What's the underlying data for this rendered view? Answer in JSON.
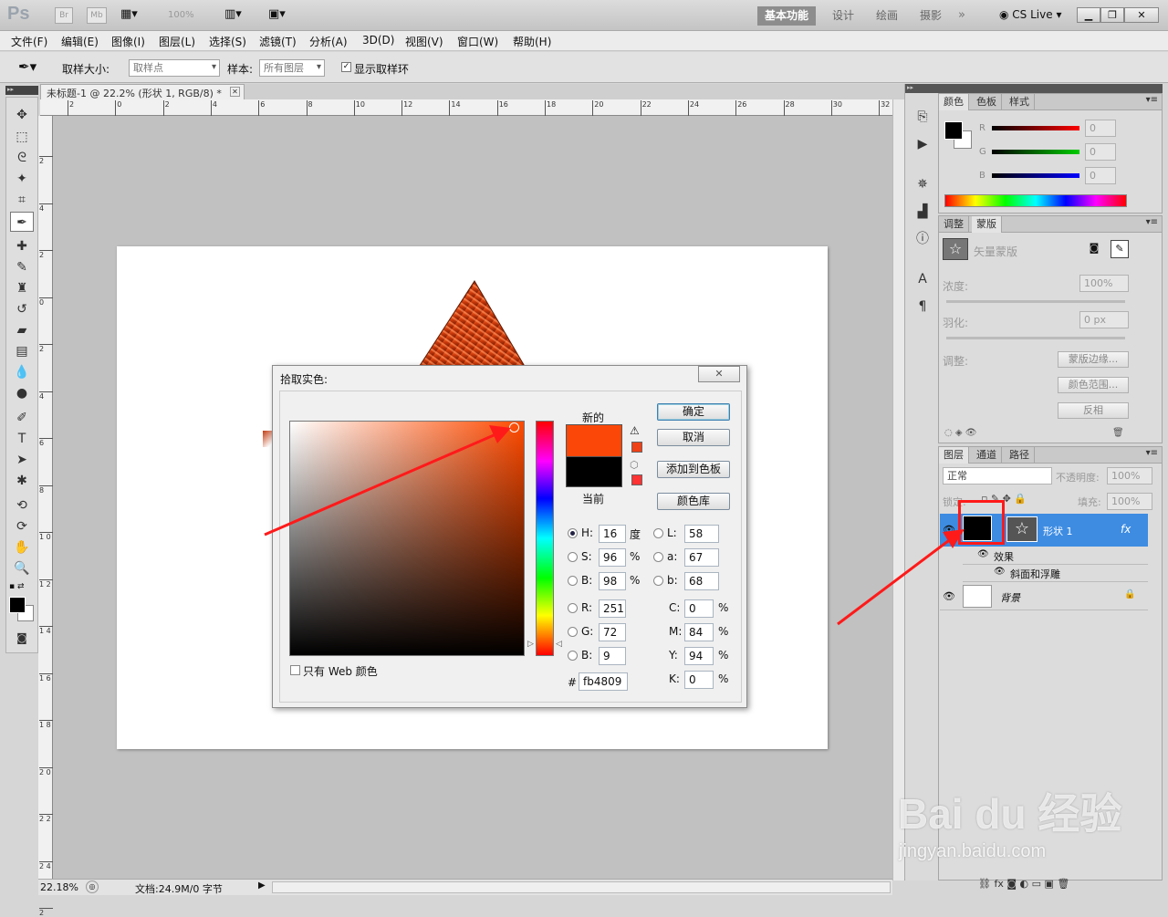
{
  "app": {
    "logo": "Ps",
    "bridge": "Br",
    "mini_bridge": "Mb",
    "zoom_select": "100%",
    "cs_live": "CS Live"
  },
  "workspaces": [
    "基本功能",
    "设计",
    "绘画",
    "摄影"
  ],
  "menu": [
    "文件(F)",
    "编辑(E)",
    "图像(I)",
    "图层(L)",
    "选择(S)",
    "滤镜(T)",
    "分析(A)",
    "3D(D)",
    "视图(V)",
    "窗口(W)",
    "帮助(H)"
  ],
  "options": {
    "sample_size_label": "取样大小:",
    "sample_size_value": "取样点",
    "sample_label": "样本:",
    "sample_value": "所有图层",
    "show_ring_label": "显示取样环",
    "show_ring_checked": true
  },
  "document": {
    "tab_title": "未标题-1 @ 22.2% (形状 1, RGB/8) *",
    "ruler_h": [
      "2",
      "0",
      "2",
      "4",
      "6",
      "8",
      "10",
      "12",
      "14",
      "16",
      "18",
      "20",
      "22",
      "24",
      "26",
      "28",
      "30",
      "32"
    ],
    "ruler_v": [
      "2",
      "4",
      "2",
      "0",
      "2",
      "4",
      "6",
      "8",
      "1 0",
      "1 2",
      "1 4",
      "1 6",
      "1 8",
      "2 0",
      "2 2",
      "2 4",
      "2"
    ]
  },
  "status": {
    "zoom": "22.18%",
    "doc_info": "文档:24.9M/0 字节"
  },
  "color_panel": {
    "tabs": [
      "颜色",
      "色板",
      "样式"
    ],
    "labels": [
      "R",
      "G",
      "B"
    ],
    "values": [
      "0",
      "0",
      "0"
    ]
  },
  "masks_panel": {
    "tabs": [
      "调整",
      "蒙版"
    ],
    "vector_mask_label": "矢量蒙版",
    "density_label": "浓度:",
    "density_value": "100%",
    "feather_label": "羽化:",
    "feather_value": "0 px",
    "refine_label": "调整:",
    "buttons": [
      "蒙版边缘...",
      "颜色范围...",
      "反相"
    ]
  },
  "layers_panel": {
    "tabs": [
      "图层",
      "通道",
      "路径"
    ],
    "blend_mode": "正常",
    "opacity_label": "不透明度:",
    "opacity_value": "100%",
    "lock_label": "锁定:",
    "fill_label": "填充:",
    "fill_value": "100%",
    "layers": [
      {
        "name": "形状 1",
        "selected": true,
        "fx": "fx"
      },
      {
        "name": "效果"
      },
      {
        "name": "斜面和浮雕"
      },
      {
        "name": "背景"
      }
    ]
  },
  "dialog": {
    "title": "拾取实色:",
    "new_label": "新的",
    "current_label": "当前",
    "new_color": "#fb4809",
    "current_color": "#000000",
    "hue_field_color": "#ff4a00",
    "buttons": {
      "ok": "确定",
      "cancel": "取消",
      "add_swatch": "添加到色板",
      "libraries": "颜色库"
    },
    "fields": {
      "H": "16",
      "S": "96",
      "B": "98",
      "R": "251",
      "G": "72",
      "B2": "9",
      "L": "58",
      "a": "67",
      "b": "68",
      "C": "0",
      "M": "84",
      "Y": "94",
      "K": "0",
      "hex": "fb4809"
    },
    "units": {
      "deg": "度",
      "pct": "%"
    },
    "labels": {
      "H": "H:",
      "S": "S:",
      "B": "B:",
      "R": "R:",
      "G": "G:",
      "B2": "B:",
      "L": "L:",
      "a": "a:",
      "b": "b:",
      "C": "C:",
      "M": "M:",
      "Y": "Y:",
      "K": "K:",
      "hash": "#"
    },
    "web_only_label": "只有 Web 颜色",
    "hue_slider_level": 0.955
  },
  "watermark": {
    "brand": "Bai du 经验",
    "url": "jingyan.baidu.com"
  }
}
